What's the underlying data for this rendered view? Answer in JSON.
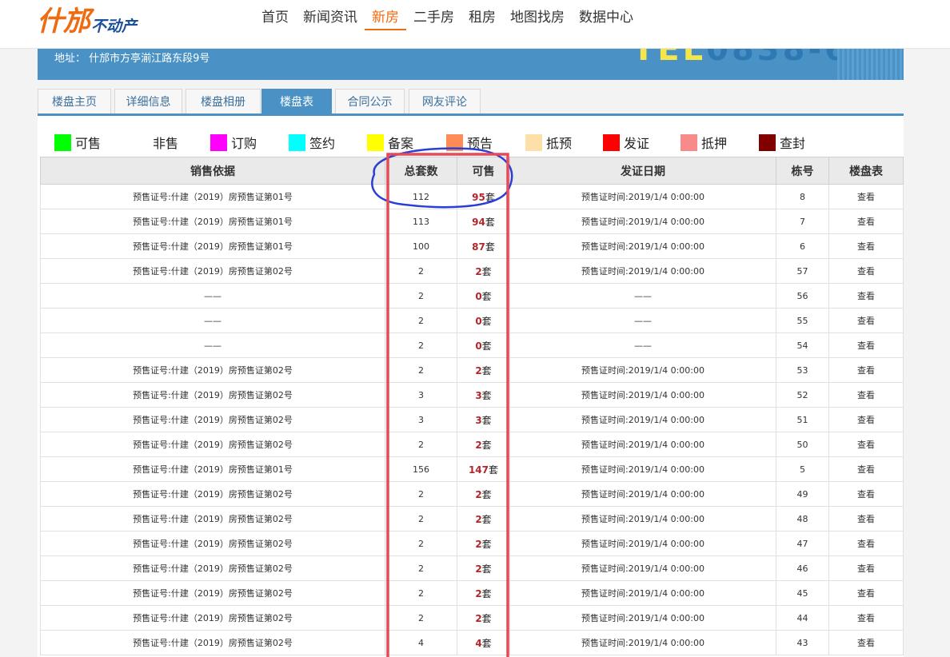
{
  "header": {
    "logo": {
      "main": "什邡",
      "sub": "不动产"
    },
    "nav": [
      {
        "label": "首页",
        "active": false
      },
      {
        "label": "新闻资讯",
        "active": false
      },
      {
        "label": "新房",
        "active": true
      },
      {
        "label": "二手房",
        "active": false
      },
      {
        "label": "租房",
        "active": false
      },
      {
        "label": "地图找房",
        "active": false
      },
      {
        "label": "数据中心",
        "active": false
      }
    ]
  },
  "banner": {
    "address": "地址： 什邡市方亭湔江路东段9号"
  },
  "tabs": [
    {
      "label": "楼盘主页",
      "active": false
    },
    {
      "label": "详细信息",
      "active": false
    },
    {
      "label": "楼盘相册",
      "active": false
    },
    {
      "label": "楼盘表",
      "active": true
    },
    {
      "label": "合同公示",
      "active": false
    },
    {
      "label": "网友评论",
      "active": false
    }
  ],
  "legend": [
    {
      "label": "可售",
      "color": "#00ff00"
    },
    {
      "label": "非售",
      "color": "#ffffff"
    },
    {
      "label": "订购",
      "color": "#ff00ff"
    },
    {
      "label": "签约",
      "color": "#00ffff"
    },
    {
      "label": "备案",
      "color": "#ffff00"
    },
    {
      "label": "预告",
      "color": "#ff8c57"
    },
    {
      "label": "抵预",
      "color": "#fde0a8"
    },
    {
      "label": "发证",
      "color": "#ff0000"
    },
    {
      "label": "抵押",
      "color": "#f88a8a"
    },
    {
      "label": "查封",
      "color": "#800000"
    }
  ],
  "table": {
    "headers": [
      "销售依据",
      "总套数",
      "可售",
      "发证日期",
      "栋号",
      "楼盘表"
    ],
    "unit": "套",
    "view_label": "查看",
    "rows": [
      {
        "basis": "预售证号:什建（2019）房预售证第01号",
        "total": "112",
        "avail": "95",
        "date": "预售证时间:2019/1/4 0:00:00",
        "building": "8"
      },
      {
        "basis": "预售证号:什建（2019）房预售证第01号",
        "total": "113",
        "avail": "94",
        "date": "预售证时间:2019/1/4 0:00:00",
        "building": "7"
      },
      {
        "basis": "预售证号:什建（2019）房预售证第01号",
        "total": "100",
        "avail": "87",
        "date": "预售证时间:2019/1/4 0:00:00",
        "building": "6"
      },
      {
        "basis": "预售证号:什建（2019）房预售证第02号",
        "total": "2",
        "avail": "2",
        "date": "预售证时间:2019/1/4 0:00:00",
        "building": "57"
      },
      {
        "basis": "——",
        "total": "2",
        "avail": "0",
        "date": "——",
        "building": "56"
      },
      {
        "basis": "——",
        "total": "2",
        "avail": "0",
        "date": "——",
        "building": "55"
      },
      {
        "basis": "——",
        "total": "2",
        "avail": "0",
        "date": "——",
        "building": "54"
      },
      {
        "basis": "预售证号:什建（2019）房预售证第02号",
        "total": "2",
        "avail": "2",
        "date": "预售证时间:2019/1/4 0:00:00",
        "building": "53"
      },
      {
        "basis": "预售证号:什建（2019）房预售证第02号",
        "total": "3",
        "avail": "3",
        "date": "预售证时间:2019/1/4 0:00:00",
        "building": "52"
      },
      {
        "basis": "预售证号:什建（2019）房预售证第02号",
        "total": "3",
        "avail": "3",
        "date": "预售证时间:2019/1/4 0:00:00",
        "building": "51"
      },
      {
        "basis": "预售证号:什建（2019）房预售证第02号",
        "total": "2",
        "avail": "2",
        "date": "预售证时间:2019/1/4 0:00:00",
        "building": "50"
      },
      {
        "basis": "预售证号:什建（2019）房预售证第01号",
        "total": "156",
        "avail": "147",
        "date": "预售证时间:2019/1/4 0:00:00",
        "building": "5"
      },
      {
        "basis": "预售证号:什建（2019）房预售证第02号",
        "total": "2",
        "avail": "2",
        "date": "预售证时间:2019/1/4 0:00:00",
        "building": "49"
      },
      {
        "basis": "预售证号:什建（2019）房预售证第02号",
        "total": "2",
        "avail": "2",
        "date": "预售证时间:2019/1/4 0:00:00",
        "building": "48"
      },
      {
        "basis": "预售证号:什建（2019）房预售证第02号",
        "total": "2",
        "avail": "2",
        "date": "预售证时间:2019/1/4 0:00:00",
        "building": "47"
      },
      {
        "basis": "预售证号:什建（2019）房预售证第02号",
        "total": "2",
        "avail": "2",
        "date": "预售证时间:2019/1/4 0:00:00",
        "building": "46"
      },
      {
        "basis": "预售证号:什建（2019）房预售证第02号",
        "total": "2",
        "avail": "2",
        "date": "预售证时间:2019/1/4 0:00:00",
        "building": "45"
      },
      {
        "basis": "预售证号:什建（2019）房预售证第02号",
        "total": "2",
        "avail": "2",
        "date": "预售证时间:2019/1/4 0:00:00",
        "building": "44"
      },
      {
        "basis": "预售证号:什建（2019）房预售证第02号",
        "total": "4",
        "avail": "4",
        "date": "预售证时间:2019/1/4 0:00:00",
        "building": "43"
      }
    ]
  },
  "annotations": {
    "ellipse_color": "#2a3fd6",
    "rect_color": "#e84a55"
  }
}
